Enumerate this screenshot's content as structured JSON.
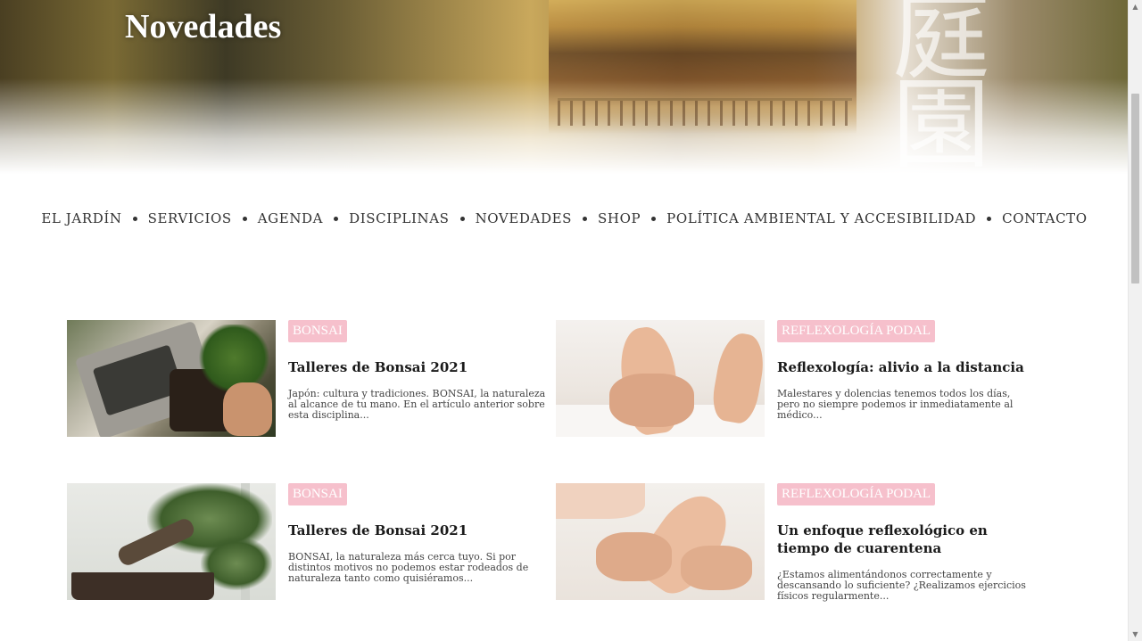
{
  "hero": {
    "title": "Novedades"
  },
  "nav": {
    "items": [
      "EL JARDÍN",
      "SERVICIOS",
      "AGENDA",
      "DISCIPLINAS",
      "NOVEDADES",
      "SHOP",
      "POLÍTICA AMBIENTAL Y ACCESIBILIDAD",
      "CONTACTO"
    ]
  },
  "posts": [
    {
      "category": "BONSAI",
      "title": "Talleres de Bonsai 2021",
      "excerpt": "Japón: cultura y tradiciones. BONSAI, la naturaleza al alcance de tu mano. En el artículo anterior sobre esta disciplina..."
    },
    {
      "category": "REFLEXOLOGÍA PODAL",
      "title": "Reflexología: alivio a la distancia",
      "excerpt": "Malestares y dolencias tenemos todos los días, pero no siempre podemos ir inmediatamente al médico..."
    },
    {
      "category": "BONSAI",
      "title": "Talleres de Bonsai 2021",
      "excerpt": "BONSAI, la naturaleza más cerca tuyo. Si por distintos motivos no podemos estar rodeados de naturaleza tanto como quisiéramos..."
    },
    {
      "category": "REFLEXOLOGÍA PODAL",
      "title": "Un enfoque reflexológico en tiempo de cuarentena",
      "excerpt": "¿Estamos alimentándonos correctamente y descansando lo suficiente? ¿Realizamos ejercicios físicos regularmente..."
    }
  ],
  "colors": {
    "tag_bg": "#f6c0cc",
    "tag_text": "#ffffff"
  },
  "icons": {
    "scroll_up": "▲",
    "scroll_down": "▼"
  }
}
